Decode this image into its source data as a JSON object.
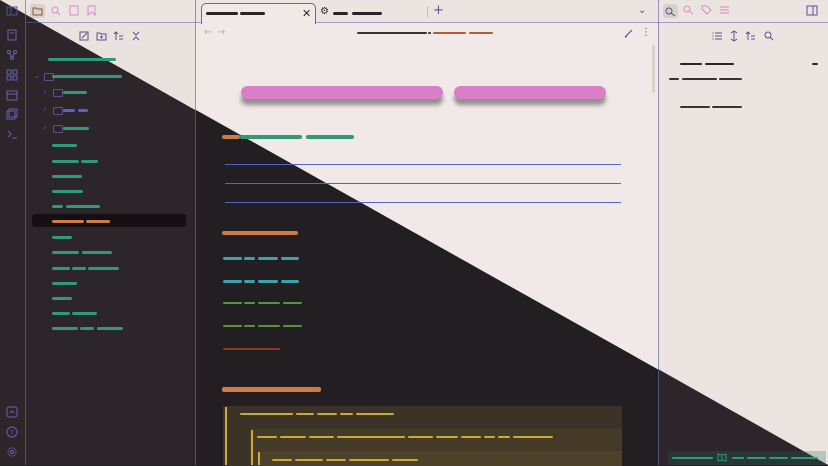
{
  "ribbon": {
    "icons": [
      "sidebar-toggle-icon",
      "new-note-icon",
      "graph-icon",
      "canvas-icon",
      "calendar-icon",
      "templates-icon",
      "terminal-icon",
      "vault-switch-icon",
      "help-icon",
      "settings-icon"
    ]
  },
  "sidebar_tabs": [
    "folder-icon",
    "search-icon",
    "file-icon",
    "bookmark-icon"
  ],
  "file_explorer": {
    "actions": [
      "new-note-icon",
      "new-folder-icon",
      "sort-icon",
      "collapse-all-icon"
    ]
  },
  "tabs": [
    {
      "icon": "none",
      "active": true
    },
    {
      "icon": "gear-icon",
      "active": false
    }
  ],
  "toolbar": {
    "nav": [
      "back-icon",
      "forward-icon"
    ],
    "actions": [
      "edit-icon",
      "more-icon"
    ]
  },
  "right_panel": {
    "header_icons": [
      "outline-icon",
      "links-icon",
      "tags-icon",
      "properties-icon"
    ],
    "outline_actions": [
      "list-icon",
      "move-icon",
      "sort-icon",
      "search-icon"
    ]
  },
  "colors": {
    "light_bg": "#f0e9e7",
    "light_panel": "#e9e2df",
    "dark_bg": "#231e21",
    "dark_panel": "#2c262b",
    "accent_green": "#2e9a77",
    "accent_orange": "#d07a46",
    "accent_pink": "#d97fc8",
    "accent_teal": "#3aa3a8",
    "accent_yellow": "#c9a93a",
    "accent_blue": "#5664c9"
  }
}
